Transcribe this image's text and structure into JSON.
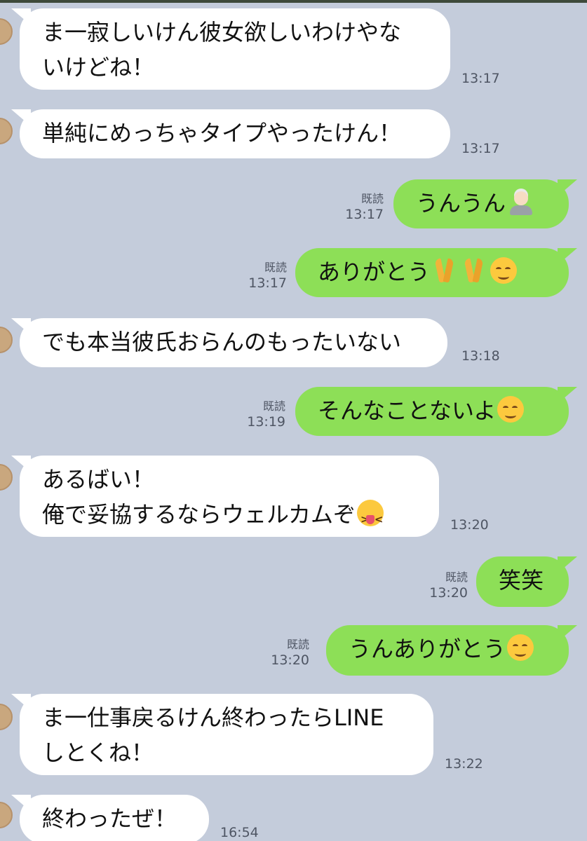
{
  "chat": {
    "read_label": "既読",
    "messages": [
      {
        "side": "in",
        "lines": [
          "ま一寂しいけん彼女欲しいわけやな",
          "いけどね！"
        ],
        "time": "13:17"
      },
      {
        "side": "in",
        "lines": [
          "単純にめっちゃタイプやったけん！"
        ],
        "time": "13:17"
      },
      {
        "side": "out",
        "text": "うんうん",
        "emoji": [
          "person-gesturing-ok-icon"
        ],
        "time": "13:17",
        "read": true
      },
      {
        "side": "out",
        "text": "ありがとう",
        "emoji": [
          "folded-hands-icon",
          "folded-hands-icon",
          "relieved-face-icon"
        ],
        "time": "13:17",
        "read": true
      },
      {
        "side": "in",
        "lines": [
          "でも本当彼氏おらんのもったいない"
        ],
        "time": "13:18"
      },
      {
        "side": "out",
        "text": "そんなことないよ",
        "emoji": [
          "relieved-face-icon"
        ],
        "time": "13:19",
        "read": true
      },
      {
        "side": "in",
        "lines": [
          "あるばい！",
          "俺で妥協するならウェルカムぞ"
        ],
        "emoji_last_line": "squinting-tongue-face-icon",
        "time": "13:20"
      },
      {
        "side": "out",
        "text": "笑笑",
        "time": "13:20",
        "read": true
      },
      {
        "side": "out",
        "text": "うんありがとう",
        "emoji": [
          "relieved-face-icon"
        ],
        "time": "13:20",
        "read": true
      },
      {
        "side": "in",
        "lines": [
          "ま一仕事戻るけん終わったらLINE",
          "しとくね！"
        ],
        "time": "13:22"
      },
      {
        "side": "in",
        "lines": [
          "終わったぜ！"
        ],
        "time": "16:54"
      }
    ]
  },
  "colors": {
    "background": "#c4ccdb",
    "incoming_bubble": "#ffffff",
    "outgoing_bubble": "#8ddf57"
  }
}
